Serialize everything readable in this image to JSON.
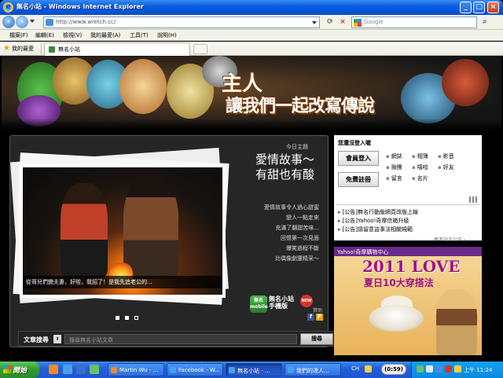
{
  "browser": {
    "title": "無名小站 - Windows Internet Explorer",
    "address": "http://www.wretch.cc/",
    "search_placeholder": "Google",
    "menu": [
      "檔案(F)",
      "編輯(E)",
      "檢視(V)",
      "我的最愛(A)",
      "工具(T)",
      "說明(H)"
    ],
    "favorites_label": "我的最愛",
    "tab_title": "無名小站"
  },
  "banner": {
    "line1": "主人",
    "line2": "讓我們一起改寫傳說"
  },
  "feature": {
    "today_label": "今日主題",
    "headline_line1": "愛情故事～",
    "headline_line2": "有甜也有酸",
    "stories": [
      "愛情故事令人過心甜蜜",
      "戀人一點走來",
      "充滿了翻甜苦味...",
      "回憶第一次見面",
      "爆笑過程不斷",
      "比偶像劇還精采～"
    ],
    "caption": "從哥兒們變夫妻，好啦，我招了！是我先追老公的...",
    "mobile_label": "無名小站手機版",
    "mobile_icon_text": "無名 mobile",
    "new_badge": "NEW",
    "sponsor_label": "贊助",
    "fb_icon": "f",
    "plurk_icon": "P"
  },
  "site_search": {
    "label": "文章搜尋",
    "placeholder": "搜尋無名小站文章",
    "button": "搜尋"
  },
  "login": {
    "title": "您還沒登入喔",
    "login_button": "會員登入",
    "register_button": "免費註冊",
    "services": [
      "網誌",
      "相簿",
      "影音",
      "揪團",
      "嘻哈",
      "好友",
      "留言",
      "名片"
    ],
    "notices": [
      "[公告]無名行動版網頁改版上線",
      "[公告]Yahoo!奇摩信箱升級",
      "[公告]請留意盜事法相關規範"
    ],
    "more": "更多站方公告 ›"
  },
  "ad": {
    "title": "Yahoo!奇摩購物中心",
    "headline": "2011 LOVE",
    "subhead": "夏日10大穿搭法"
  },
  "taskbar": {
    "start": "開始",
    "windows": [
      "Martin Wu - ...",
      "Facebook - W...",
      "無名小站 - ...",
      "我們的達人..."
    ],
    "lang": "CH",
    "ime": "(0:59)",
    "clock": "上午 11:24"
  },
  "colors": {
    "titlebar": "#0a5fe0",
    "taskbar": "#245edb",
    "accent_purple": "#a0128a"
  }
}
